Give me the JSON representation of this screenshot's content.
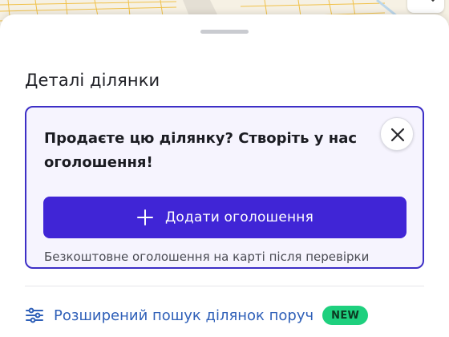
{
  "panel": {
    "title": "Деталі ділянки"
  },
  "promo": {
    "title": "Продаєте цю ділянку? Створіть у нас оголошення!",
    "add_button_label": "Додати оголошення",
    "note": "Безкоштовне оголошення на карті після перевірки"
  },
  "advanced_search": {
    "label": "Розширений пошук ділянок поруч",
    "badge": "NEW"
  },
  "icons": {
    "close": "close-icon",
    "plus": "plus-icon",
    "filters": "sliders-icon"
  },
  "colors": {
    "accent": "#4025d6",
    "link": "#2e5fb8",
    "badge": "#1ed07e"
  }
}
